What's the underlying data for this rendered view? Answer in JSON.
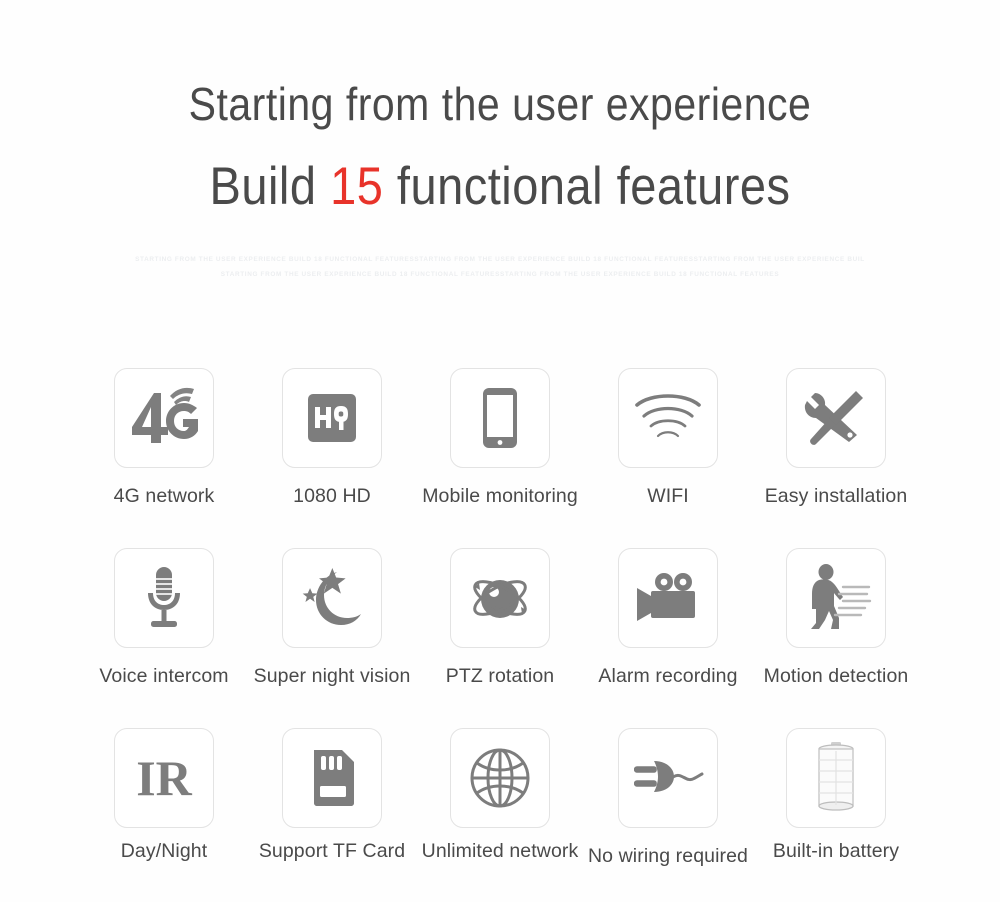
{
  "heading": {
    "line1": "Starting from the user experience",
    "line2_prefix": "Build ",
    "line2_accent": "15",
    "line2_suffix": " functional features",
    "accent_color": "#e8332a"
  },
  "microtext": {
    "line1": "STARTING FROM THE USER EXPERIENCE BUILD 18 FUNCTIONAL FEATURESSTARTING FROM THE USER EXPERIENCE BUILD 18 FUNCTIONAL FEATURESSTARTING FROM THE USER EXPERIENCE BUIL",
    "line2": "STARTING FROM THE USER EXPERIENCE BUILD 18 FUNCTIONAL FEATURESSTARTING FROM THE USER EXPERIENCE BUILD 18 FUNCTIONAL FEATURES",
    "color": "#eceef0"
  },
  "icon_color": "#7d7d7d",
  "tile_border_color": "#e3e3e3",
  "features": {
    "rows": [
      [
        {
          "label": "4G network",
          "icon": "4g-network-icon"
        },
        {
          "label": "1080 HD",
          "icon": "hq-video-icon"
        },
        {
          "label": "Mobile monitoring",
          "icon": "smartphone-icon"
        },
        {
          "label": "WIFI",
          "icon": "wifi-icon"
        },
        {
          "label": "Easy installation",
          "icon": "tools-icon"
        }
      ],
      [
        {
          "label": "Voice intercom",
          "icon": "microphone-icon"
        },
        {
          "label": "Super night vision",
          "icon": "moon-stars-icon"
        },
        {
          "label": "PTZ rotation",
          "icon": "orbit-sphere-icon"
        },
        {
          "label": "Alarm recording",
          "icon": "movie-camera-icon"
        },
        {
          "label": "Motion detection",
          "icon": "walking-person-icon"
        }
      ],
      [
        {
          "label": "Day/Night",
          "icon": "ir-text-icon"
        },
        {
          "label": "Support TF Card",
          "icon": "sd-card-icon"
        },
        {
          "label": "Unlimited network",
          "icon": "globe-icon"
        },
        {
          "label": "No wiring required",
          "icon": "power-plug-icon"
        },
        {
          "label": "Built-in battery",
          "icon": "battery-cell-icon"
        }
      ]
    ]
  }
}
